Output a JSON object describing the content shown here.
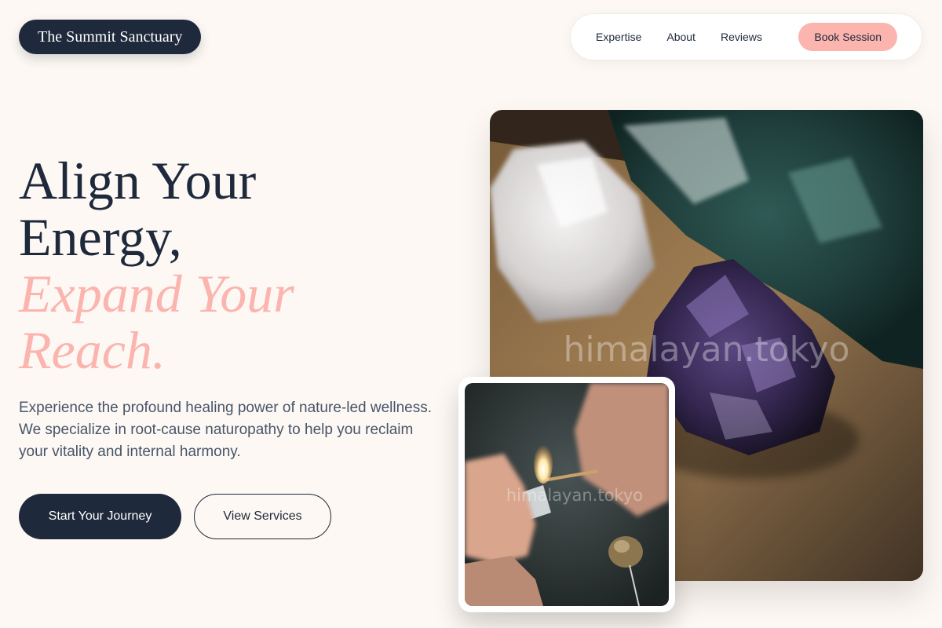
{
  "header": {
    "logo": "The Summit Sanctuary",
    "nav": {
      "links": [
        "Expertise",
        "About",
        "Reviews"
      ],
      "cta": "Book Session"
    }
  },
  "hero": {
    "title_line1": "Align Your",
    "title_line2": "Energy,",
    "accent_line1": "Expand Your",
    "accent_line2": "Reach.",
    "description": "Experience the profound healing power of nature-led wellness. We specialize in root-cause naturopathy to help you reclaim your vitality and internal harmony.",
    "primary_button": "Start Your Journey",
    "secondary_button": "View Services"
  },
  "images": {
    "main_watermark": "himalayan.tokyo",
    "secondary_watermark": "himalayan.tokyo"
  },
  "colors": {
    "background": "#fdf8f3",
    "primary": "#1e293b",
    "accent": "#fbb4ae",
    "body_text": "#475569"
  }
}
